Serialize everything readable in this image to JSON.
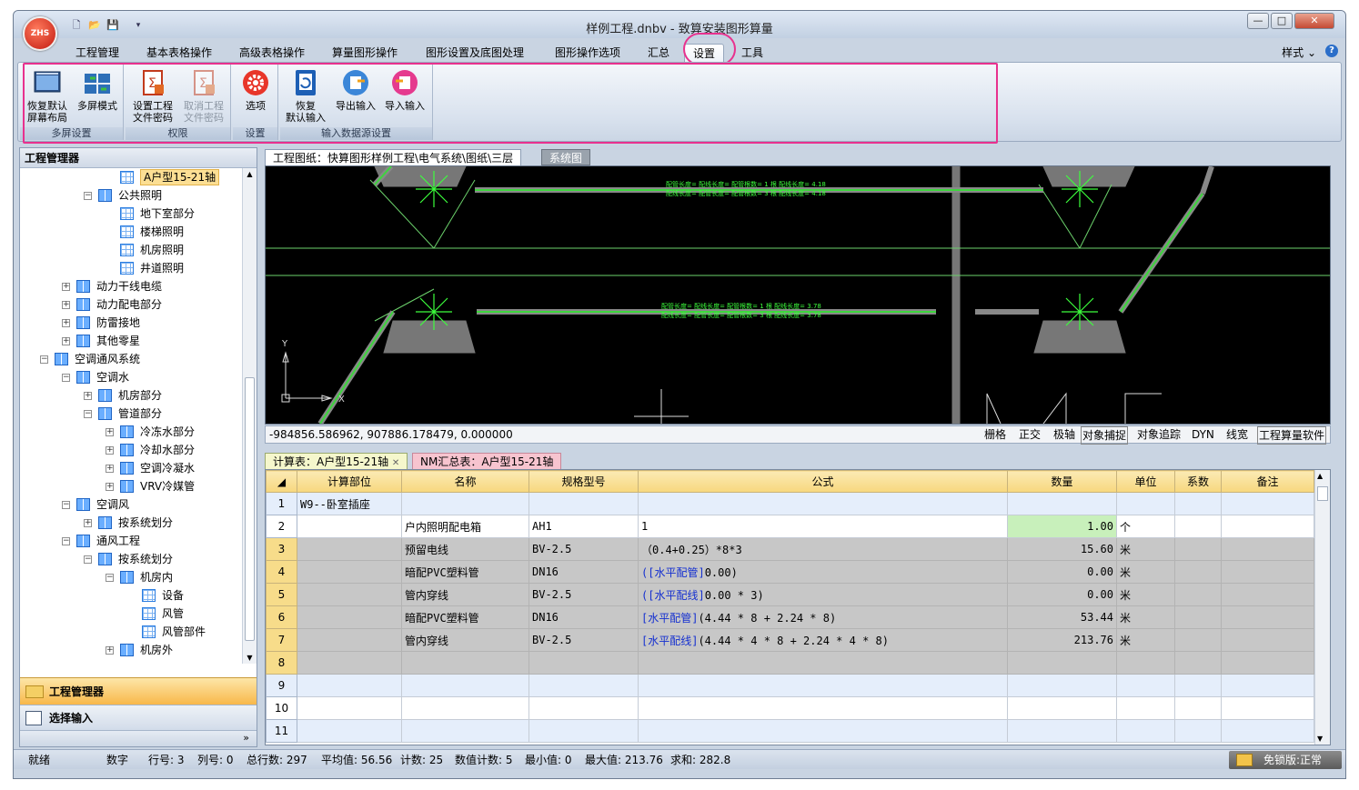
{
  "window": {
    "title": "样例工程.dnbv - 致算安装图形算量",
    "logo_text": "ZHS",
    "min": "—",
    "max": "□",
    "close": "✕"
  },
  "ribbon": {
    "tabs": [
      "工程管理",
      "基本表格操作",
      "高级表格操作",
      "算量图形操作",
      "图形设置及底图处理",
      "图形操作选项",
      "汇总",
      "设置",
      "工具"
    ],
    "active_tab": "设置",
    "style_label": "样式",
    "groups": [
      {
        "label": "多屏设置",
        "buttons": [
          {
            "label": "恢复默认\n屏幕布局"
          },
          {
            "label": "多屏模式"
          }
        ]
      },
      {
        "label": "权限",
        "buttons": [
          {
            "label": "设置工程\n文件密码"
          },
          {
            "label": "取消工程\n文件密码",
            "disabled": true
          }
        ]
      },
      {
        "label": "设置",
        "buttons": [
          {
            "label": "选项"
          }
        ]
      },
      {
        "label": "输入数据源设置",
        "buttons": [
          {
            "label": "恢复\n默认输入"
          },
          {
            "label": "导出输入"
          },
          {
            "label": "导入输入"
          }
        ]
      }
    ]
  },
  "left_panel": {
    "title": "工程管理器",
    "tree": [
      {
        "label": "A户型15-21轴",
        "level": 4,
        "leaf": true,
        "selected": true
      },
      {
        "label": "公共照明",
        "level": 3,
        "exp": "−"
      },
      {
        "label": "地下室部分",
        "level": 4,
        "leaf": true
      },
      {
        "label": "楼梯照明",
        "level": 4,
        "leaf": true
      },
      {
        "label": "机房照明",
        "level": 4,
        "leaf": true
      },
      {
        "label": "井道照明",
        "level": 4,
        "leaf": true
      },
      {
        "label": "动力干线电缆",
        "level": 2,
        "exp": "+"
      },
      {
        "label": "动力配电部分",
        "level": 2,
        "exp": "+"
      },
      {
        "label": "防雷接地",
        "level": 2,
        "exp": "+"
      },
      {
        "label": "其他零星",
        "level": 2,
        "exp": "+"
      },
      {
        "label": "空调通风系统",
        "level": 1,
        "exp": "−"
      },
      {
        "label": "空调水",
        "level": 2,
        "exp": "−"
      },
      {
        "label": "机房部分",
        "level": 3,
        "exp": "+"
      },
      {
        "label": "管道部分",
        "level": 3,
        "exp": "−"
      },
      {
        "label": "冷冻水部分",
        "level": 4,
        "exp": "+"
      },
      {
        "label": "冷却水部分",
        "level": 4,
        "exp": "+"
      },
      {
        "label": "空调冷凝水",
        "level": 4,
        "exp": "+"
      },
      {
        "label": "VRV冷媒管",
        "level": 4,
        "exp": "+"
      },
      {
        "label": "空调风",
        "level": 2,
        "exp": "−"
      },
      {
        "label": "按系统划分",
        "level": 3,
        "exp": "+"
      },
      {
        "label": "通风工程",
        "level": 2,
        "exp": "−"
      },
      {
        "label": "按系统划分",
        "level": 3,
        "exp": "−"
      },
      {
        "label": "机房内",
        "level": 4,
        "exp": "−"
      },
      {
        "label": "设备",
        "level": 5,
        "leaf": true
      },
      {
        "label": "风管",
        "level": 5,
        "leaf": true
      },
      {
        "label": "风管部件",
        "level": 5,
        "leaf": true
      },
      {
        "label": "机房外",
        "level": 4,
        "exp": "+"
      }
    ],
    "nav": [
      "工程管理器",
      "选择输入"
    ],
    "more": "»"
  },
  "drawing": {
    "tab1": "工程图纸：快算图形样例工程\\电气系统\\图纸\\三层",
    "tab2": "系统图",
    "coords": "-984856.586962,  907886.178479,  0.000000",
    "toggles": [
      "栅格",
      "正交",
      "极轴",
      "对象捕捉",
      "对象追踪",
      "DYN",
      "线宽",
      "工程算量软件"
    ],
    "axis_y": "Y",
    "axis_x": "X",
    "annot1a": "配管长度= 配线长度= 配管根数= 1 根 配线长度= 4.18",
    "annot1b": "配线长度= 配管长度= 配管根数= 3 根 配线长度= 4.18",
    "annot2a": "配管长度= 配线长度= 配管根数= 1 根 配线长度= 3.78",
    "annot2b": "配线长度= 配管长度= 配管根数= 3 根 配线长度= 3.78"
  },
  "grid": {
    "tab1": "计算表：A户型15-21轴",
    "tab2": "NM汇总表：A户型15-21轴",
    "headers": [
      "计算部位",
      "名称",
      "规格型号",
      "公式",
      "数量",
      "单位",
      "系数",
      "备注"
    ],
    "rows": [
      {
        "n": "1",
        "part": "W9--卧室插座",
        "name": "",
        "spec": "",
        "formula": "",
        "tag": "",
        "qty": "",
        "unit": ""
      },
      {
        "n": "2",
        "part": "",
        "name": "户内照明配电箱",
        "spec": "AH1",
        "formula": "1",
        "tag": "",
        "qty": "1.00",
        "unit": "个"
      },
      {
        "n": "3",
        "part": "",
        "name": "预留电线",
        "spec": "BV-2.5",
        "formula": "（0.4+0.25）*8*3",
        "tag": "",
        "qty": "15.60",
        "unit": "米"
      },
      {
        "n": "4",
        "part": "",
        "name": "暗配PVC塑料管",
        "spec": "DN16",
        "formula": "0.00)",
        "tag": "([水平配管]",
        "qty": "0.00",
        "unit": "米"
      },
      {
        "n": "5",
        "part": "",
        "name": "管内穿线",
        "spec": "BV-2.5",
        "formula": "0.00 * 3)",
        "tag": "([水平配线]",
        "qty": "0.00",
        "unit": "米"
      },
      {
        "n": "6",
        "part": "",
        "name": "暗配PVC塑料管",
        "spec": "DN16",
        "formula": "(4.44 * 8 + 2.24 * 8)",
        "tag": "[水平配管]",
        "qty": "53.44",
        "unit": "米"
      },
      {
        "n": "7",
        "part": "",
        "name": "管内穿线",
        "spec": "BV-2.5",
        "formula": "(4.44 * 4 * 8 + 2.24 * 4 * 8)",
        "tag": "[水平配线]",
        "qty": "213.76",
        "unit": "米"
      },
      {
        "n": "8",
        "part": "",
        "name": "",
        "spec": "",
        "formula": "",
        "tag": "",
        "qty": "",
        "unit": ""
      },
      {
        "n": "9",
        "part": "",
        "name": "",
        "spec": "",
        "formula": "",
        "tag": "",
        "qty": "",
        "unit": ""
      },
      {
        "n": "10",
        "part": "",
        "name": "",
        "spec": "",
        "formula": "",
        "tag": "",
        "qty": "",
        "unit": ""
      },
      {
        "n": "11",
        "part": "",
        "name": "",
        "spec": "",
        "formula": "",
        "tag": "",
        "qty": "",
        "unit": ""
      }
    ]
  },
  "status": {
    "ready": "就绪",
    "num": "数字",
    "row": "行号: 3",
    "col": "列号: 0",
    "total": "总行数: 297",
    "avg": "平均值: 56.56",
    "count": "计数: 25",
    "numcount": "数值计数: 5",
    "min": "最小值: 0",
    "max": "最大值: 213.76",
    "sum": "求和: 282.8",
    "edition": "免锁版:正常"
  }
}
